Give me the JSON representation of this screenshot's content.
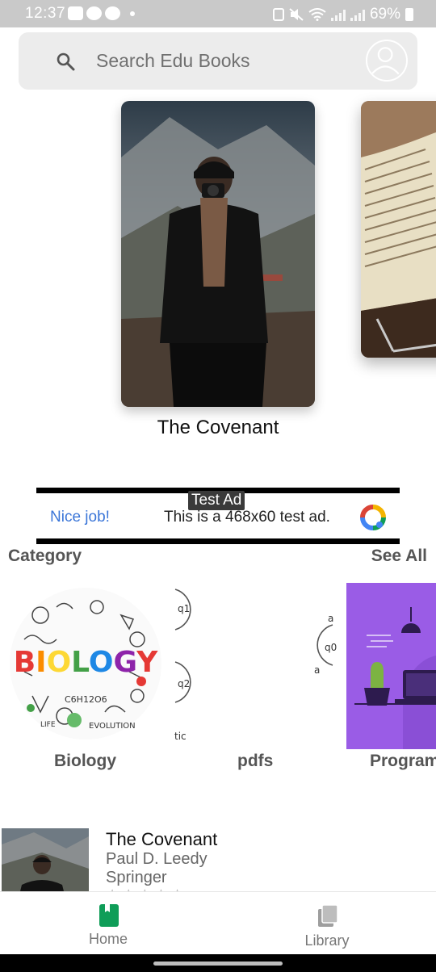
{
  "status_bar": {
    "time": "12:37",
    "battery": "69%"
  },
  "search": {
    "placeholder": "Search Edu Books"
  },
  "featured": {
    "title": "The Covenant"
  },
  "ad": {
    "label": "Test Ad",
    "nice_job": "Nice job!",
    "text": "This is a 468x60 test ad."
  },
  "category_section": {
    "title": "Category",
    "see_all": "See All",
    "items": [
      {
        "label": "Biology"
      },
      {
        "label": "pdfs"
      },
      {
        "label": "Program"
      }
    ],
    "pdfs_thumb_text": {
      "q1": "q1",
      "q2": "q2",
      "a_top": "a",
      "q0": "q0",
      "a_bottom": "a",
      "tic": "tic"
    }
  },
  "book_list": [
    {
      "title": "The Covenant",
      "author": "Paul D. Leedy",
      "publisher": "Springer",
      "stars": "★★★★★"
    }
  ],
  "bottom_nav": {
    "home": "Home",
    "library": "Library"
  },
  "colors": {
    "accent_green": "#0f9d58",
    "ad_blue": "#3b76d8",
    "program_purple": "#9a5ce6"
  }
}
